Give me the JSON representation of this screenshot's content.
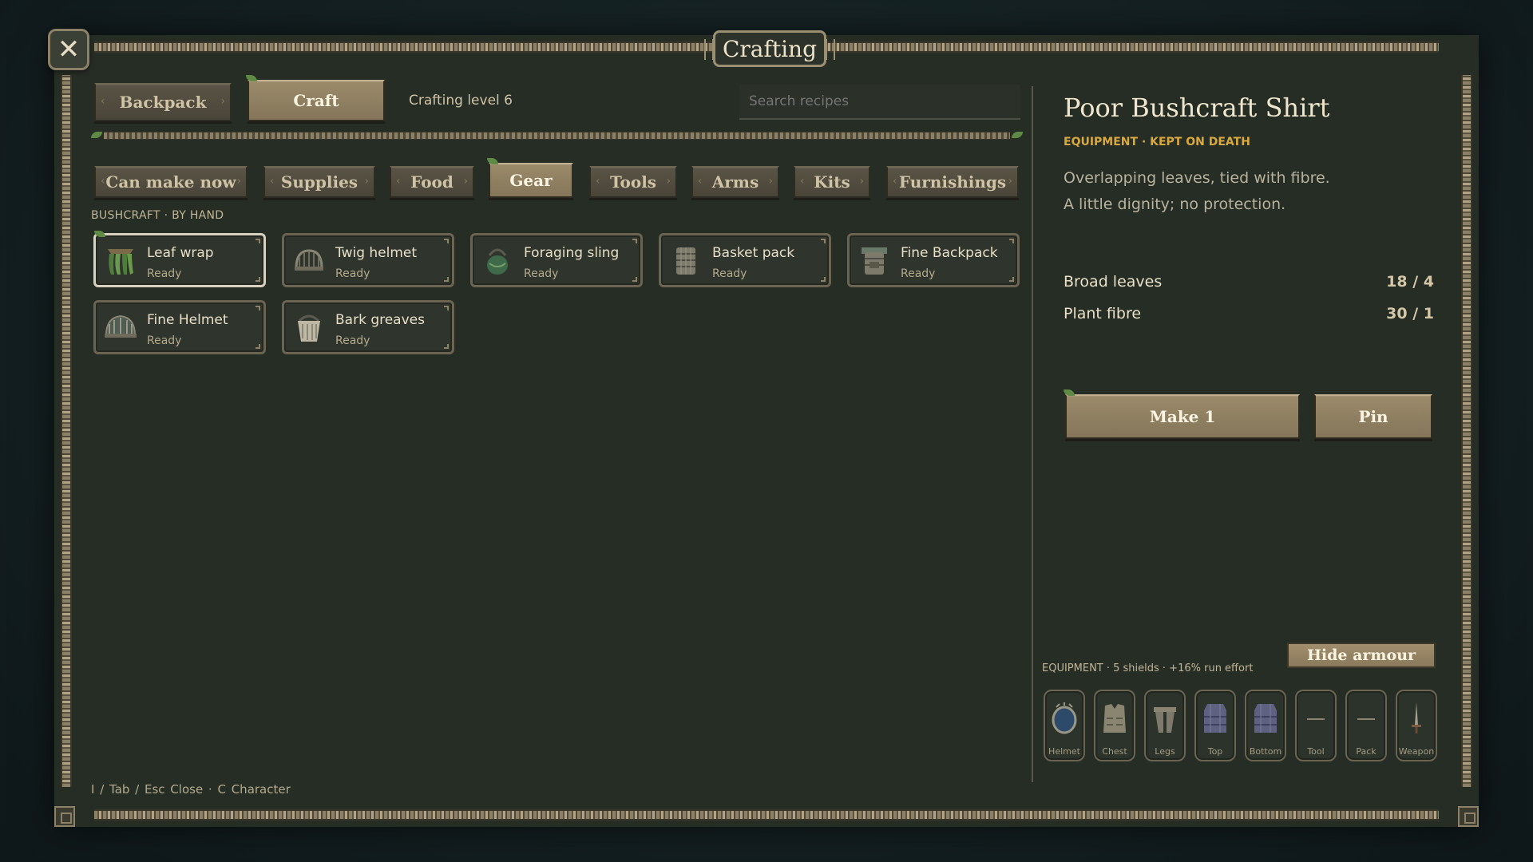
{
  "window": {
    "title": "Crafting",
    "close_icon": "crossed-tools-icon"
  },
  "top_tabs": [
    {
      "label": "Backpack",
      "active": false
    },
    {
      "label": "Craft",
      "active": true
    }
  ],
  "crafting_level": "Crafting level 6",
  "search": {
    "placeholder": "Search recipes",
    "value": ""
  },
  "categories": [
    {
      "label": "Can make now",
      "active": false
    },
    {
      "label": "Supplies",
      "active": false
    },
    {
      "label": "Food",
      "active": false
    },
    {
      "label": "Gear",
      "active": true
    },
    {
      "label": "Tools",
      "active": false
    },
    {
      "label": "Arms",
      "active": false
    },
    {
      "label": "Kits",
      "active": false
    },
    {
      "label": "Furnishings",
      "active": false
    }
  ],
  "section_label": "BUSHCRAFT · BY HAND",
  "recipes": [
    {
      "name": "Leaf wrap",
      "status": "Ready",
      "icon": "leaf-wrap-icon",
      "selected": true
    },
    {
      "name": "Twig helmet",
      "status": "Ready",
      "icon": "twig-helmet-icon",
      "selected": false
    },
    {
      "name": "Foraging sling",
      "status": "Ready",
      "icon": "foraging-sling-icon",
      "selected": false
    },
    {
      "name": "Basket pack",
      "status": "Ready",
      "icon": "basket-pack-icon",
      "selected": false
    },
    {
      "name": "Fine Backpack",
      "status": "Ready",
      "icon": "fine-backpack-icon",
      "selected": false
    },
    {
      "name": "Fine Helmet",
      "status": "Ready",
      "icon": "fine-helmet-icon",
      "selected": false
    },
    {
      "name": "Bark greaves",
      "status": "Ready",
      "icon": "bark-greaves-icon",
      "selected": false
    }
  ],
  "detail": {
    "title": "Poor Bushcraft Shirt",
    "tags": "EQUIPMENT · KEPT ON DEATH",
    "description": [
      "Overlapping leaves, tied with fibre.",
      "A little dignity; no protection."
    ],
    "materials": [
      {
        "name": "Broad leaves",
        "qty": "18 / 4"
      },
      {
        "name": "Plant fibre",
        "qty": "30 / 1"
      }
    ],
    "make_label": "Make 1",
    "pin_label": "Pin"
  },
  "equipment": {
    "hide_label": "Hide armour",
    "summary": "EQUIPMENT · 5 shields · +16% run effort",
    "slots": [
      {
        "label": "Helmet",
        "filled": true,
        "icon": "helmet-icon"
      },
      {
        "label": "Chest",
        "filled": true,
        "icon": "chest-armor-icon"
      },
      {
        "label": "Legs",
        "filled": true,
        "icon": "legs-armor-icon"
      },
      {
        "label": "Top",
        "filled": true,
        "icon": "top-armor-icon"
      },
      {
        "label": "Bottom",
        "filled": true,
        "icon": "bottom-armor-icon"
      },
      {
        "label": "Tool",
        "filled": false,
        "icon": ""
      },
      {
        "label": "Pack",
        "filled": false,
        "icon": ""
      },
      {
        "label": "Weapon",
        "filled": true,
        "icon": "sword-icon"
      }
    ]
  },
  "footer": {
    "hint": "I / Tab / Esc Close  ·  C Character"
  },
  "colors": {
    "accent_gold": "#d9a93e",
    "panel_bg": "#262d25",
    "wood_active": "#9b8a6a"
  }
}
